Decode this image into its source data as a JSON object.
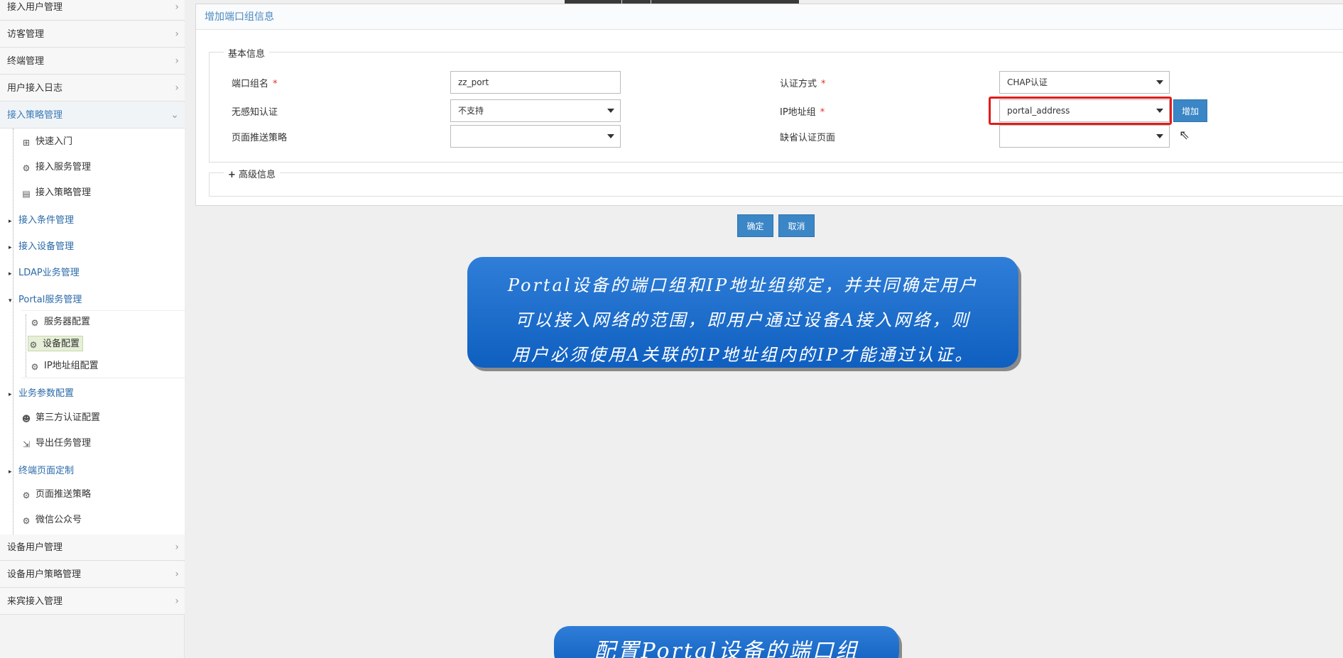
{
  "sidebar": {
    "top_items": [
      {
        "label": "接入用户管理"
      },
      {
        "label": "访客管理"
      },
      {
        "label": "终端管理"
      },
      {
        "label": "用户接入日志"
      },
      {
        "label": "接入策略管理"
      }
    ],
    "sub_items": [
      {
        "label": "快速入门",
        "icon": "flowchart-icon"
      },
      {
        "label": "接入服务管理",
        "icon": "service-icon"
      },
      {
        "label": "接入策略管理",
        "icon": "policy-icon"
      }
    ],
    "groups": [
      {
        "label": "接入条件管理"
      },
      {
        "label": "接入设备管理"
      },
      {
        "label": "LDAP业务管理"
      },
      {
        "label": "Portal服务管理"
      }
    ],
    "portal_children": [
      {
        "label": "服务器配置",
        "icon": "server-config-icon"
      },
      {
        "label": "设备配置",
        "icon": "device-config-icon"
      },
      {
        "label": "IP地址组配置",
        "icon": "ip-group-icon"
      }
    ],
    "group_business": {
      "label": "业务参数配置"
    },
    "sub_items2": [
      {
        "label": "第三方认证配置",
        "icon": "third-party-icon"
      },
      {
        "label": "导出任务管理",
        "icon": "export-icon"
      }
    ],
    "group_terminal": {
      "label": "终端页面定制"
    },
    "sub_items3": [
      {
        "label": "页面推送策略",
        "icon": "page-push-icon"
      },
      {
        "label": "微信公众号",
        "icon": "wechat-icon"
      }
    ],
    "bottom_items": [
      {
        "label": "设备用户管理"
      },
      {
        "label": "设备用户策略管理"
      },
      {
        "label": "来宾接入管理"
      }
    ]
  },
  "form": {
    "title": "增加端口组信息",
    "basic_legend": "基本信息",
    "advanced_legend": "高级信息",
    "advanced_toggle": "+",
    "port_group_name_label": "端口组名",
    "port_group_name_value": "zz_port",
    "auth_method_label": "认证方式",
    "auth_method_value": "CHAP认证",
    "seamless_auth_label": "无感知认证",
    "seamless_auth_value": "不支持",
    "ip_group_label": "IP地址组",
    "ip_group_value": "portal_address",
    "add_button": "增加",
    "page_push_label": "页面推送策略",
    "page_push_value": "",
    "default_auth_page_label": "缺省认证页面",
    "default_auth_page_value": "",
    "required_mark": "*",
    "confirm_button": "确定",
    "cancel_button": "取消"
  },
  "callouts": {
    "main_lines": [
      "Portal设备的端口组和IP地址组绑定，并共同确定用户",
      "可以接入网络的范围，即用户通过设备A接入网络，则",
      "用户必须使用A关联的IP地址组内的IP才能通过认证。"
    ],
    "caption": "配置Portal设备的端口组"
  },
  "chevron_right": "›",
  "chevron_down": "⌄",
  "triangle_right": "▸",
  "triangle_down": "▾"
}
